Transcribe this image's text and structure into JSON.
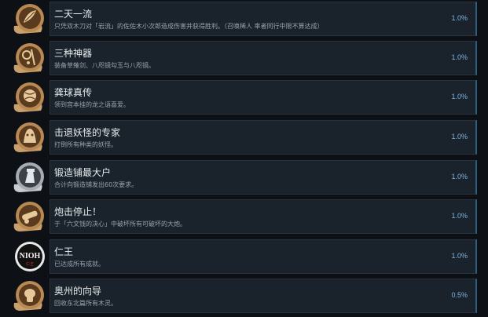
{
  "achievements": [
    {
      "title": "二天一流",
      "desc": "只凭双木刀对「岩流」的佐佐木小次郎造成伤害并获得胜利。（召唤稀人 率者同行中限不算达成）",
      "percent": "1.0%",
      "icon": "leaf-medal-icon"
    },
    {
      "title": "三种神器",
      "desc": "装备草薙剑、八咫镜勾玉与八咫镜。",
      "percent": "1.0%",
      "icon": "sacred-treasures-medal-icon"
    },
    {
      "title": "龚球真传",
      "desc": "领到宫本挂的龙之语喜爱。",
      "percent": "1.0%",
      "icon": "ball-medal-icon"
    },
    {
      "title": "击退妖怪的专家",
      "desc": "打倒所有种类的妖怪。",
      "percent": "1.0%",
      "icon": "yokai-medal-icon"
    },
    {
      "title": "锻造铺最大户",
      "desc": "合计向锻造铺发出60次要求。",
      "percent": "1.0%",
      "icon": "blacksmith-medal-icon"
    },
    {
      "title": "炮击停止！",
      "desc": "于「六文钱的决心」中破坏所有可破坏的大炮。",
      "percent": "1.0%",
      "icon": "cannon-medal-icon"
    },
    {
      "title": "仁王",
      "desc": "已达成所有成就。",
      "percent": "1.0%",
      "icon": "nioh-logo-icon",
      "logo_text": "NIOH",
      "logo_sub": "仁王"
    },
    {
      "title": "奥州的向导",
      "desc": "回收东北篇所有木灵。",
      "percent": "0.5%",
      "icon": "kodama-medal-icon"
    }
  ]
}
